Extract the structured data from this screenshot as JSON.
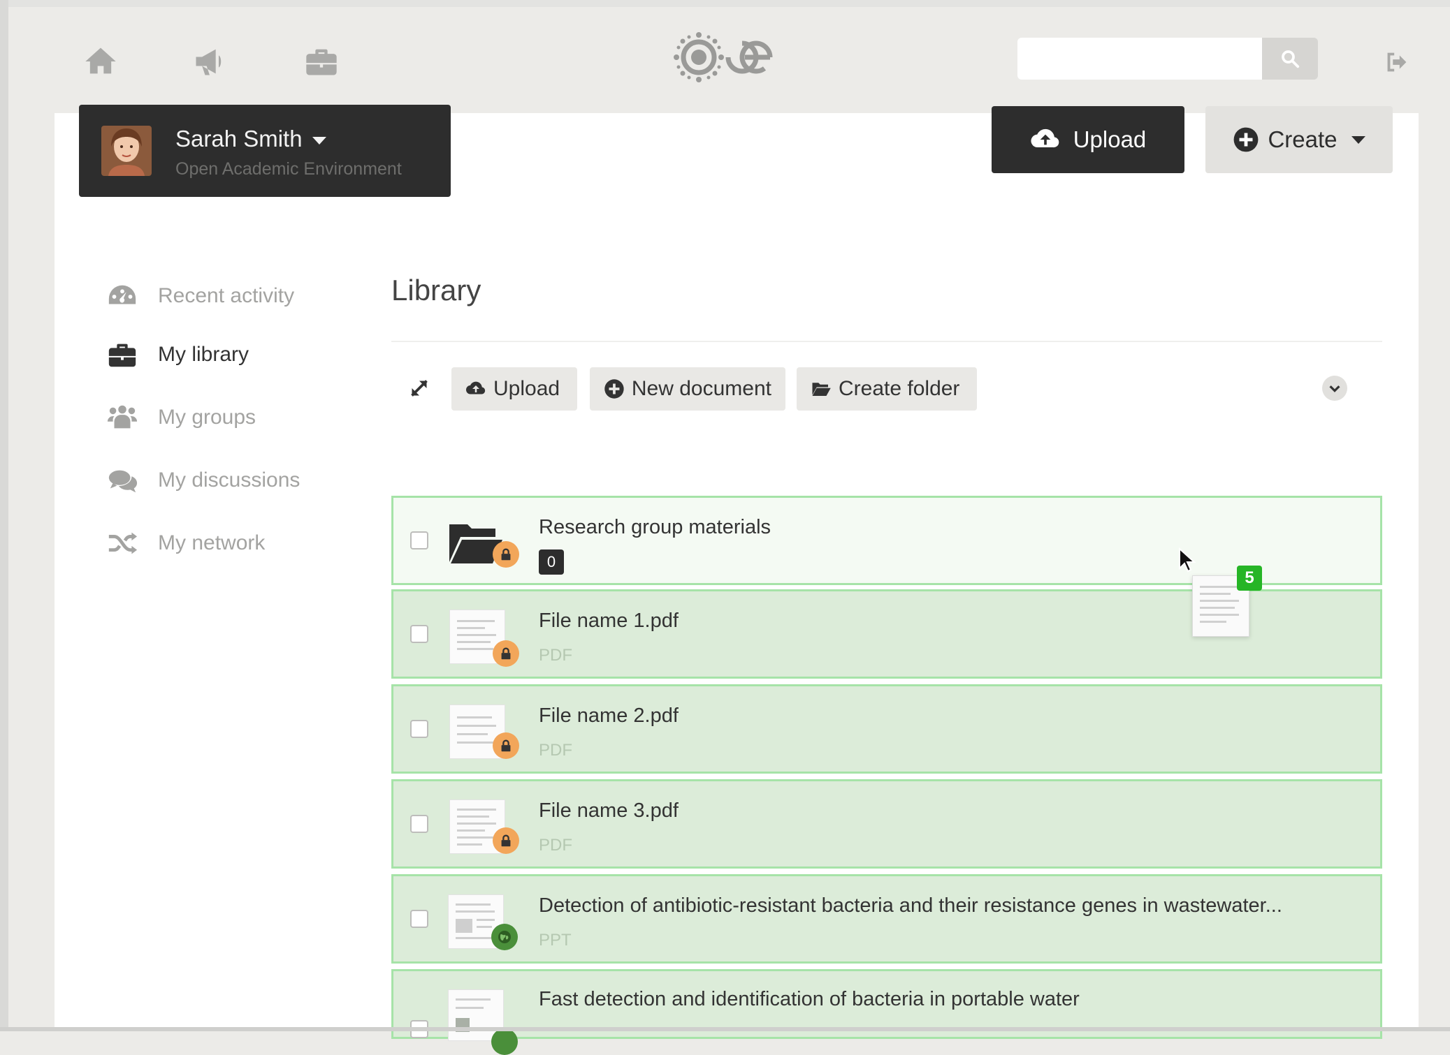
{
  "topbar": {
    "nav_icons": [
      "home-icon",
      "megaphone-icon",
      "briefcase-icon"
    ],
    "search": {
      "placeholder": "",
      "value": ""
    },
    "search_icon": "search-icon",
    "signout_icon": "sign-out-icon"
  },
  "user": {
    "name": "Sarah Smith",
    "tenant": "Open Academic Environment"
  },
  "actions": {
    "upload_label": "Upload",
    "create_label": "Create"
  },
  "sidebar": {
    "items": [
      {
        "label": "Recent activity",
        "icon": "dashboard-icon",
        "active": false
      },
      {
        "label": "My library",
        "icon": "briefcase-icon",
        "active": true
      },
      {
        "label": "My groups",
        "icon": "group-icon",
        "active": false
      },
      {
        "label": "My discussions",
        "icon": "comments-icon",
        "active": false
      },
      {
        "label": "My network",
        "icon": "shuffle-icon",
        "active": false
      }
    ]
  },
  "library": {
    "title": "Library",
    "toolbar": {
      "upload_label": "Upload",
      "new_document_label": "New document",
      "create_folder_label": "Create folder"
    },
    "items": [
      {
        "title": "Research group materials",
        "kind": "folder",
        "count": "0",
        "visibility": "private"
      },
      {
        "title": "File name 1.pdf",
        "kind": "file",
        "type": "PDF",
        "visibility": "private"
      },
      {
        "title": "File name 2.pdf",
        "kind": "file",
        "type": "PDF",
        "visibility": "private"
      },
      {
        "title": "File name 3.pdf",
        "kind": "file",
        "type": "PDF",
        "visibility": "private"
      },
      {
        "title": "Detection of antibiotic-resistant bacteria and their resistance genes in wastewater...",
        "kind": "file",
        "type": "PPT",
        "visibility": "public"
      },
      {
        "title": "Fast detection and identification of bacteria in portable water",
        "kind": "file",
        "type": "",
        "visibility": "public"
      }
    ]
  },
  "drag": {
    "count": "5"
  },
  "colors": {
    "dark": "#2d2d2d",
    "row_selected": "#dcecd9",
    "row_border": "#a6e3a8",
    "lock_badge": "#f2a65a",
    "public_badge": "#4a8f3a",
    "drag_count_badge": "#26b526"
  }
}
